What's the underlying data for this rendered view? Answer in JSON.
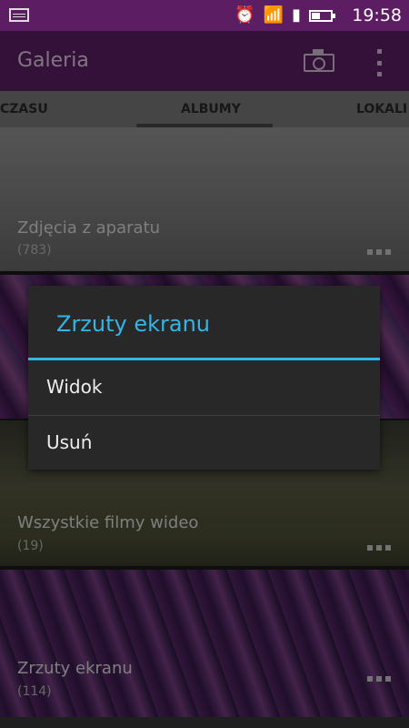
{
  "status": {
    "time": "19:58"
  },
  "app": {
    "title": "Galeria"
  },
  "tabs": [
    {
      "label": "CZASU"
    },
    {
      "label": "ALBUMY"
    },
    {
      "label": "LOKALI"
    }
  ],
  "albums": [
    {
      "label": "Zdjęcia z aparatu",
      "count": "(783)"
    },
    {
      "label": "",
      "count": ""
    },
    {
      "label": "Wszystkie filmy wideo",
      "count": "(19)"
    },
    {
      "label": "Zrzuty ekranu",
      "count": "(114)"
    }
  ],
  "dialog": {
    "title": "Zrzuty ekranu",
    "items": [
      {
        "label": "Widok"
      },
      {
        "label": "Usuń"
      }
    ]
  },
  "colors": {
    "accent": "#33b5e5",
    "appbar": "#5f1f68",
    "statusbar": "#5c1d63"
  }
}
